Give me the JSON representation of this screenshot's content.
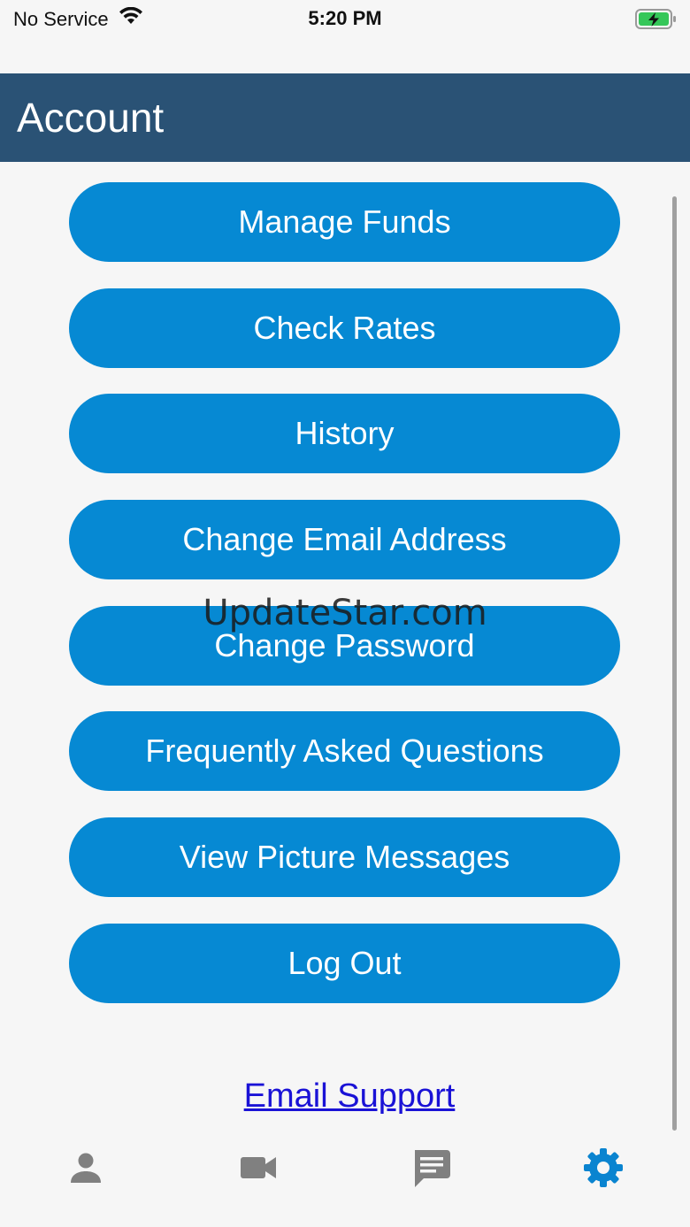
{
  "status_bar": {
    "carrier": "No Service",
    "time": "5:20 PM",
    "wifi_icon": "wifi-icon",
    "battery_icon": "battery-charging-icon"
  },
  "header": {
    "title": "Account"
  },
  "menu": {
    "items": [
      {
        "label": "Manage Funds"
      },
      {
        "label": "Check Rates"
      },
      {
        "label": "History"
      },
      {
        "label": "Change Email Address"
      },
      {
        "label": "Change Password"
      },
      {
        "label": "Frequently Asked Questions"
      },
      {
        "label": "View Picture Messages"
      },
      {
        "label": "Log Out"
      }
    ]
  },
  "watermark": "UpdateStar.com",
  "support": {
    "label": "Email Support"
  },
  "tabbar": {
    "tabs": [
      {
        "icon": "person-icon",
        "active": false
      },
      {
        "icon": "video-camera-icon",
        "active": false
      },
      {
        "icon": "chat-icon",
        "active": false
      },
      {
        "icon": "gear-icon",
        "active": true
      }
    ]
  },
  "colors": {
    "header_bg": "#2a5275",
    "button_bg": "#0689d3",
    "link": "#1a12d6",
    "tab_inactive": "#808080",
    "tab_active": "#0a84d0",
    "battery_green": "#35c759"
  }
}
